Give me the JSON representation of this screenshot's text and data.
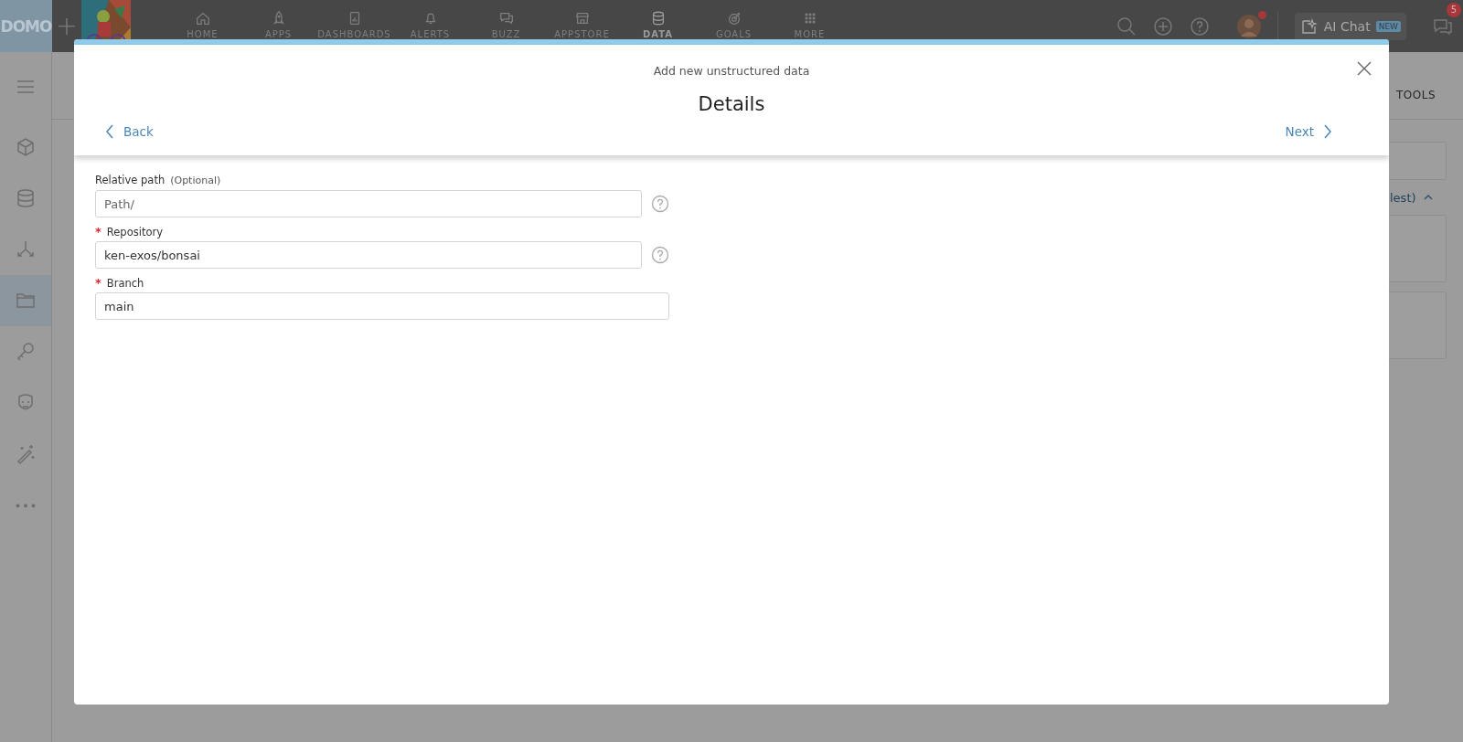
{
  "top_nav": {
    "logo": "DOMO",
    "add": "+",
    "items": [
      {
        "label": "HOME",
        "kind": "home",
        "selected": false
      },
      {
        "label": "APPS",
        "kind": "apps",
        "selected": false
      },
      {
        "label": "DASHBOARDS",
        "kind": "dashboards",
        "selected": false
      },
      {
        "label": "ALERTS",
        "kind": "alerts",
        "selected": false
      },
      {
        "label": "BUZZ",
        "kind": "buzz",
        "selected": false
      },
      {
        "label": "APPSTORE",
        "kind": "appstore",
        "selected": false
      },
      {
        "label": "DATA",
        "kind": "data",
        "selected": true
      },
      {
        "label": "GOALS",
        "kind": "goals",
        "selected": false
      },
      {
        "label": "MORE",
        "kind": "more",
        "selected": false
      }
    ],
    "ai_chat": {
      "label": "AI Chat",
      "badge": "NEW"
    },
    "message_count": "5"
  },
  "sidebar": {
    "items": [
      {
        "kind": "cube",
        "selected": false
      },
      {
        "kind": "database",
        "selected": false
      },
      {
        "kind": "fork",
        "selected": false
      },
      {
        "kind": "folder",
        "selected": true
      },
      {
        "kind": "key",
        "selected": false
      },
      {
        "kind": "face",
        "selected": false
      },
      {
        "kind": "wand",
        "selected": false
      },
      {
        "kind": "more",
        "selected": false
      }
    ]
  },
  "background": {
    "tab": "TOOLS",
    "link": "lest)"
  },
  "modal": {
    "subtitle": "Add new unstructured data",
    "title": "Details",
    "back": "Back",
    "next": "Next",
    "fields": [
      {
        "label": "Relative path",
        "note": "(Optional)",
        "placeholder": "Path/",
        "help": true
      },
      {
        "required_mark": "*",
        "label": "Repository",
        "value": "ken-exos/bonsai",
        "help": true
      },
      {
        "required_mark": "*",
        "label": "Branch",
        "value": "main",
        "help": false
      }
    ]
  }
}
